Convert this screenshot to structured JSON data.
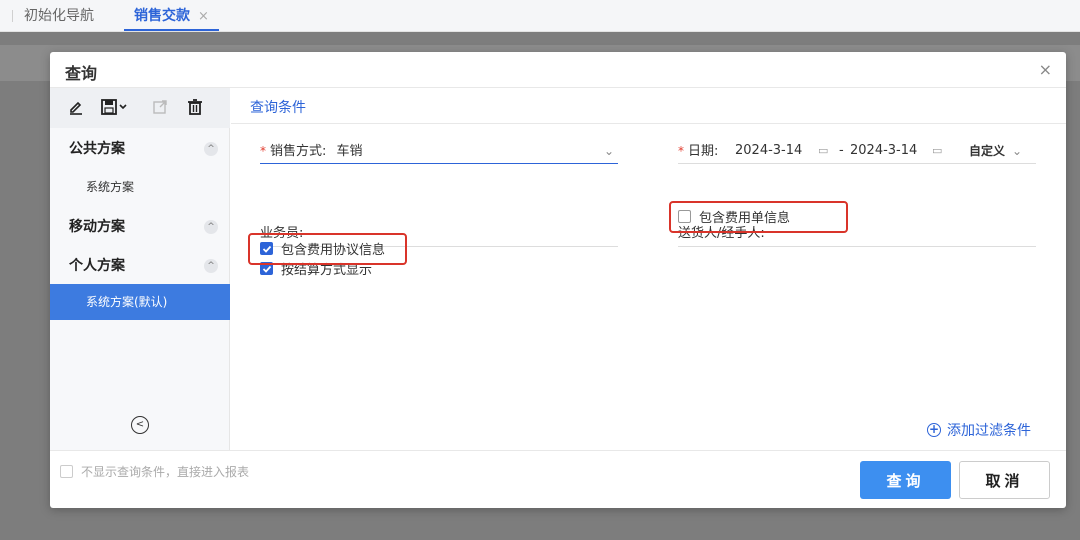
{
  "tabs": [
    {
      "label": "初始化导航"
    },
    {
      "label": "销售交款",
      "close": "×"
    }
  ],
  "dialog": {
    "title": "查询",
    "close": "×"
  },
  "left": {
    "groups": [
      {
        "label": "公共方案",
        "chevron": "^"
      },
      {
        "label": "移动方案",
        "chevron": "^"
      },
      {
        "label": "个人方案",
        "chevron": "^"
      }
    ],
    "items": [
      {
        "label": "系统方案"
      },
      {
        "label": "系统方案(默认)"
      }
    ],
    "collapse": "<"
  },
  "right": {
    "tab_label": "查询条件",
    "sale_method": {
      "label": "销售方式:",
      "value": "车销"
    },
    "date": {
      "label": "日期:",
      "from": "2024-3-14",
      "sep": "-",
      "to": "2024-3-14",
      "range_type": "自定义"
    },
    "salesperson": {
      "label": "业务员:"
    },
    "deliverer": {
      "label": "送货人/经手人:"
    },
    "checkboxes": [
      {
        "label": "按结算方式显示",
        "checked": true
      },
      {
        "label": "包含费用协议信息",
        "checked": true
      },
      {
        "label": "包含费用单信息",
        "checked": false
      }
    ],
    "add_filter": "添加过滤条件"
  },
  "footer": {
    "skip_label": "不显示查询条件，直接进入报表",
    "query_button": "查询",
    "cancel_button": "取消"
  },
  "colors": {
    "accent": "#2d64d8",
    "highlight": "#d9342a",
    "primary_button": "#3d8ff0"
  }
}
